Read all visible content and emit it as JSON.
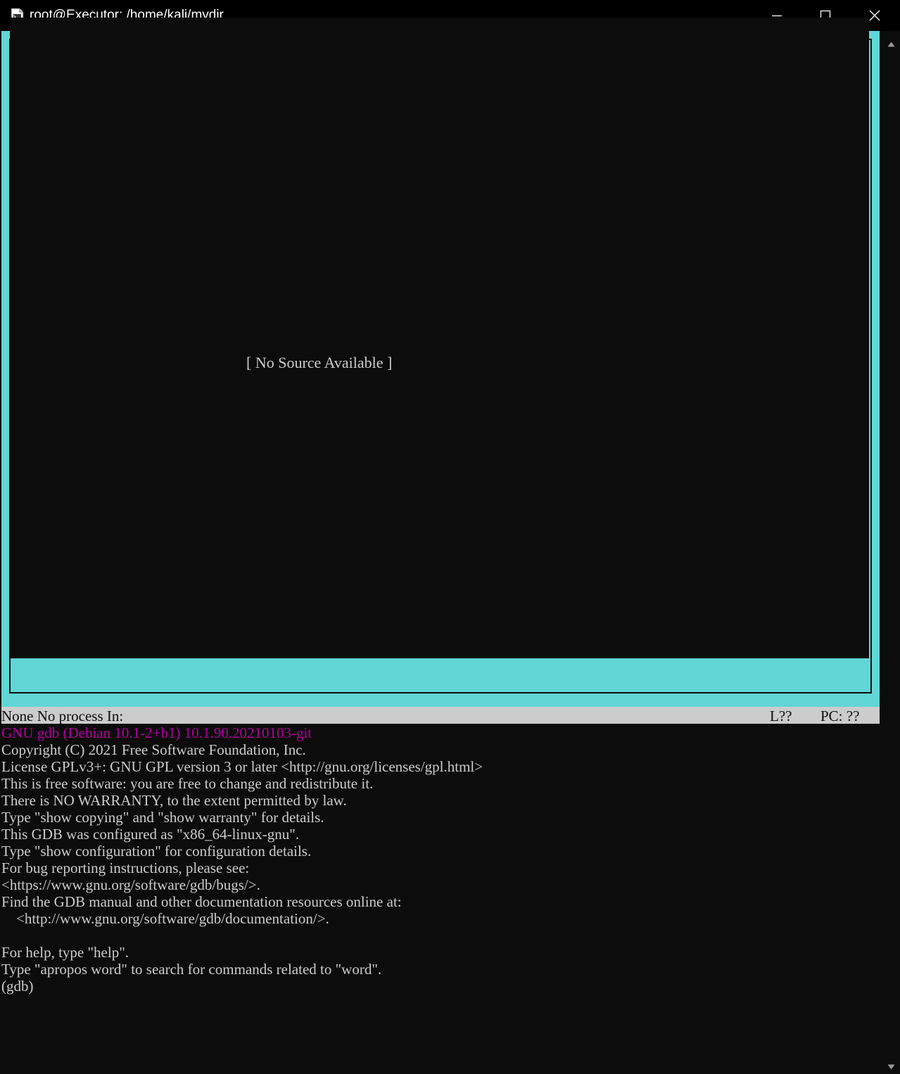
{
  "window": {
    "title": "root@Executor: /home/kali/mydir",
    "icon": "terminal-app-icon",
    "controls": [
      "minimize-icon",
      "maximize-icon",
      "close-icon"
    ]
  },
  "source_window": {
    "message": "[ No Source Available ]",
    "border_color": "#61d6d6"
  },
  "status_bar": {
    "left": "None No process In:",
    "line": "L??",
    "pc": "PC: ??"
  },
  "console": {
    "banner": "GNU gdb (Debian 10.1-2+b1) 10.1.90.20210103-git",
    "banner_color": "#b4009e",
    "lines": [
      "Copyright (C) 2021 Free Software Foundation, Inc.",
      "License GPLv3+: GNU GPL version 3 or later <http://gnu.org/licenses/gpl.html>",
      "This is free software: you are free to change and redistribute it.",
      "There is NO WARRANTY, to the extent permitted by law.",
      "Type \"show copying\" and \"show warranty\" for details.",
      "This GDB was configured as \"x86_64-linux-gnu\".",
      "Type \"show configuration\" for configuration details.",
      "For bug reporting instructions, please see:",
      "<https://www.gnu.org/software/gdb/bugs/>.",
      "Find the GDB manual and other documentation resources online at:",
      "    <http://www.gnu.org/software/gdb/documentation/>.",
      "",
      "For help, type \"help\".",
      "Type \"apropos word\" to search for commands related to \"word\"."
    ],
    "prompt": "(gdb)"
  }
}
